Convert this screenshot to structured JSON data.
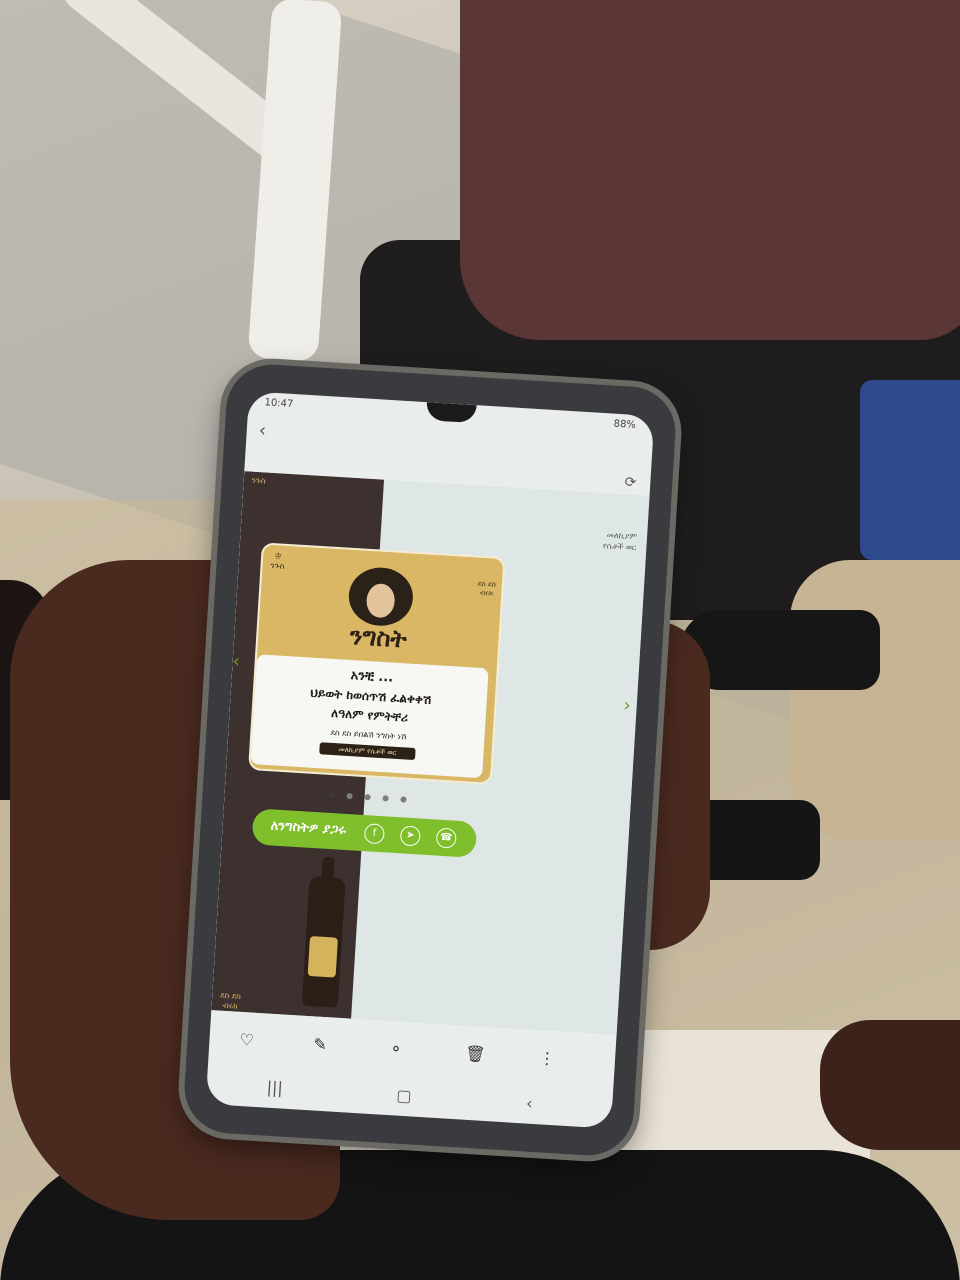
{
  "status_bar": {
    "time": "10:47",
    "battery": "88%"
  },
  "promo_top_text": [
    "መለኪያም",
    "የሴቶች ወር"
  ],
  "brand_logo_left": "ንጉስ",
  "brand_logo_right": [
    "ደስ ደስ",
    "ብሩክ"
  ],
  "card": {
    "brand_name": "ንግስት",
    "line1": "አንቺ ...",
    "line2": "ህይወት ከወሰጥሽ ፈልቀቀሽ",
    "line3": "ለዓለም የምትቸሪ",
    "line4": "ደስ ደስ ይበልሽ ንግስት ነሽ",
    "pill": "መለኪያም የሴቶች ወር"
  },
  "share": {
    "label": "ለንግስትዎ ያጋሩ"
  },
  "colors": {
    "card_gold": "#d9b764",
    "share_green": "#7fbf2c",
    "brown_panel": "#3d3130"
  },
  "icons": {
    "nav_back": "arrow-left-icon",
    "rotate": "rotate-icon",
    "share_facebook": "facebook-icon",
    "share_telegram": "telegram-icon",
    "share_whatsapp": "whatsapp-icon",
    "tool_heart": "heart-icon",
    "tool_edit": "pencil-icon",
    "tool_share": "share-icon",
    "tool_delete": "trash-icon",
    "tool_more": "more-icon"
  }
}
